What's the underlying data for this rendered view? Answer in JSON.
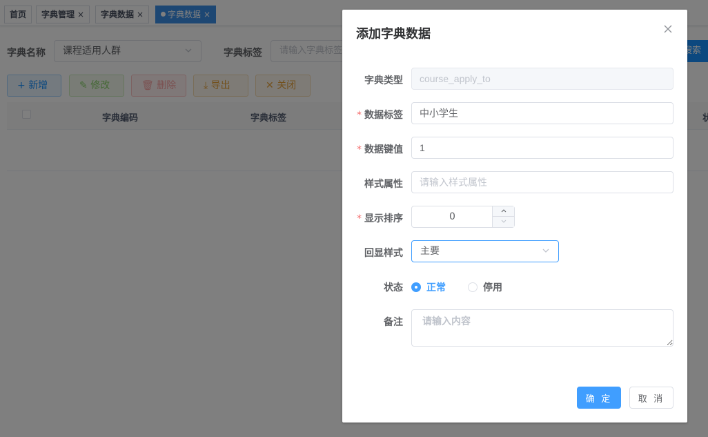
{
  "tags": [
    {
      "label": "首页",
      "closable": false
    },
    {
      "label": "字典管理",
      "closable": true
    },
    {
      "label": "字典数据",
      "closable": true
    },
    {
      "label": "字典数据",
      "closable": true,
      "active": true
    }
  ],
  "tag_close_glyph": "×",
  "search": {
    "dict_name_label": "字典名称",
    "dict_name_value": "课程适用人群",
    "dict_label_label": "字典标签",
    "dict_label_placeholder": "请输入字典标签",
    "search_button": "搜索"
  },
  "toolbar": {
    "add": "新增",
    "edit": "修改",
    "delete": "删除",
    "export": "导出",
    "close": "关闭"
  },
  "table": {
    "columns": [
      "字典编码",
      "字典标签",
      "状"
    ]
  },
  "dialog": {
    "title": "添加字典数据",
    "fields": {
      "dict_type": {
        "label": "字典类型",
        "value": "course_apply_to",
        "disabled": true
      },
      "data_label": {
        "label": "数据标签",
        "value": "中小学生",
        "required": true
      },
      "data_value": {
        "label": "数据键值",
        "value": "1",
        "required": true
      },
      "css_class": {
        "label": "样式属性",
        "placeholder": "请输入样式属性"
      },
      "sort": {
        "label": "显示排序",
        "value": "0",
        "required": true
      },
      "list_class": {
        "label": "回显样式",
        "value": "主要"
      },
      "status": {
        "label": "状态",
        "options": [
          "正常",
          "停用"
        ],
        "selected": "正常"
      },
      "remark": {
        "label": "备注",
        "placeholder": "请输入内容"
      }
    },
    "required_mark": "*",
    "confirm": "确 定",
    "cancel": "取 消"
  },
  "colors": {
    "primary": "#409eff",
    "tag_active": "#3a8ee6",
    "required": "#f56c6c",
    "overlay": "rgba(0,0,0,0.5)"
  },
  "icons": {
    "add": "plus-icon",
    "edit": "edit-icon",
    "delete": "trash-icon",
    "export": "download-icon",
    "close": "close-icon",
    "select": "chevron-down-icon"
  }
}
